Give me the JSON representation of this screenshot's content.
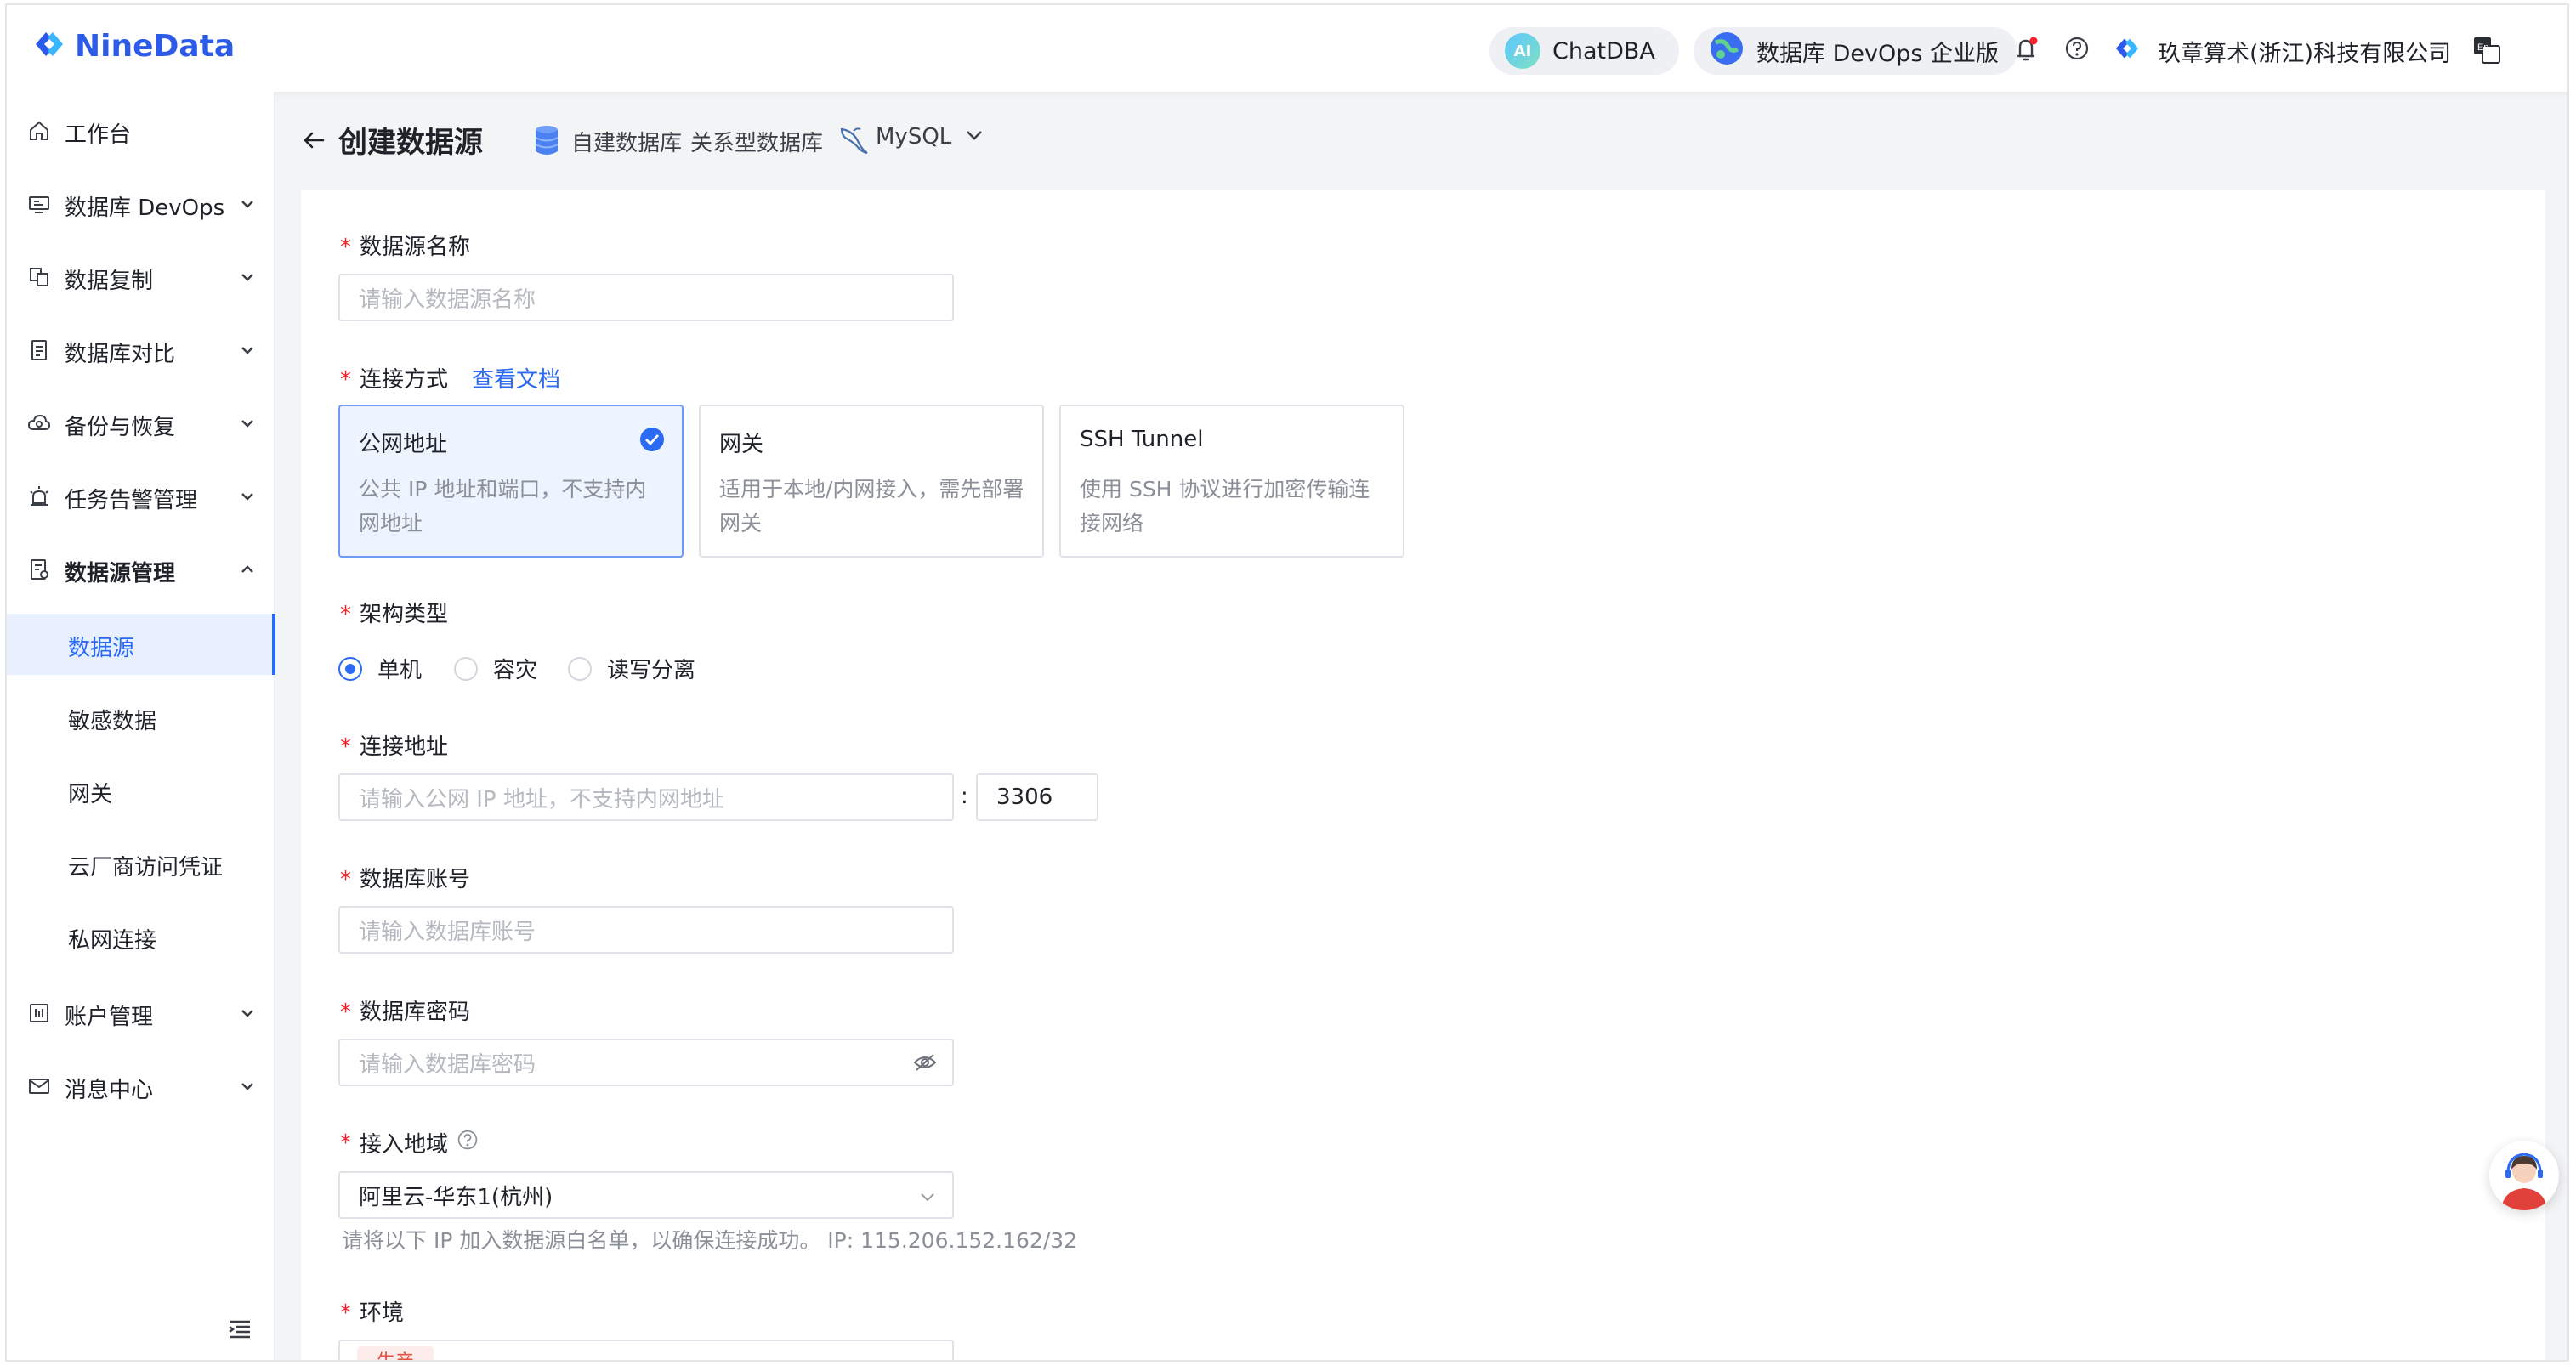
{
  "header": {
    "logo_text": "NineData",
    "chatdba_label": "ChatDBA",
    "chatdba_badge": "AI",
    "edition_label": "数据库 DevOps 企业版",
    "company": "玖章算术(浙江)科技有限公司"
  },
  "sidebar": {
    "items": [
      {
        "label": "工作台",
        "icon": "home-icon"
      },
      {
        "label": "数据库 DevOps",
        "icon": "monitor-icon"
      },
      {
        "label": "数据复制",
        "icon": "copy-icon"
      },
      {
        "label": "数据库对比",
        "icon": "compare-icon"
      },
      {
        "label": "备份与恢复",
        "icon": "cloud-backup-icon"
      },
      {
        "label": "任务告警管理",
        "icon": "alarm-icon"
      },
      {
        "label": "数据源管理",
        "icon": "datasource-icon"
      },
      {
        "label": "账户管理",
        "icon": "account-icon"
      },
      {
        "label": "消息中心",
        "icon": "mail-icon"
      }
    ],
    "sub_items": [
      "数据源",
      "敏感数据",
      "网关",
      "云厂商访问凭证",
      "私网连接"
    ]
  },
  "page": {
    "title": "创建数据源",
    "crumb_1": "自建数据库",
    "crumb_2": "关系型数据库",
    "crumb_3": "MySQL"
  },
  "form": {
    "name_label": "数据源名称",
    "name_placeholder": "请输入数据源名称",
    "conn_label": "连接方式",
    "conn_doc_link": "查看文档",
    "conn_options": [
      {
        "title": "公网地址",
        "desc": "公共 IP 地址和端口，不支持内网地址",
        "selected": true
      },
      {
        "title": "网关",
        "desc": "适用于本地/内网接入，需先部署网关",
        "selected": false
      },
      {
        "title": "SSH Tunnel",
        "desc": "使用 SSH 协议进行加密传输连接网络",
        "selected": false
      }
    ],
    "arch_label": "架构类型",
    "arch_options": [
      "单机",
      "容灾",
      "读写分离"
    ],
    "arch_selected": "单机",
    "addr_label": "连接地址",
    "addr_placeholder": "请输入公网 IP 地址，不支持内网地址",
    "addr_sep": ":",
    "port_value": "3306",
    "account_label": "数据库账号",
    "account_placeholder": "请输入数据库账号",
    "password_label": "数据库密码",
    "password_placeholder": "请输入数据库密码",
    "region_label": "接入地域",
    "region_value": "阿里云-华东1(杭州)",
    "region_hint": "请将以下 IP 加入数据源白名单，以确保连接成功。 IP: 115.206.152.162/32",
    "env_label": "环境",
    "env_value": "生产"
  },
  "colors": {
    "primary": "#2b6bf3",
    "required": "#f5222d"
  }
}
